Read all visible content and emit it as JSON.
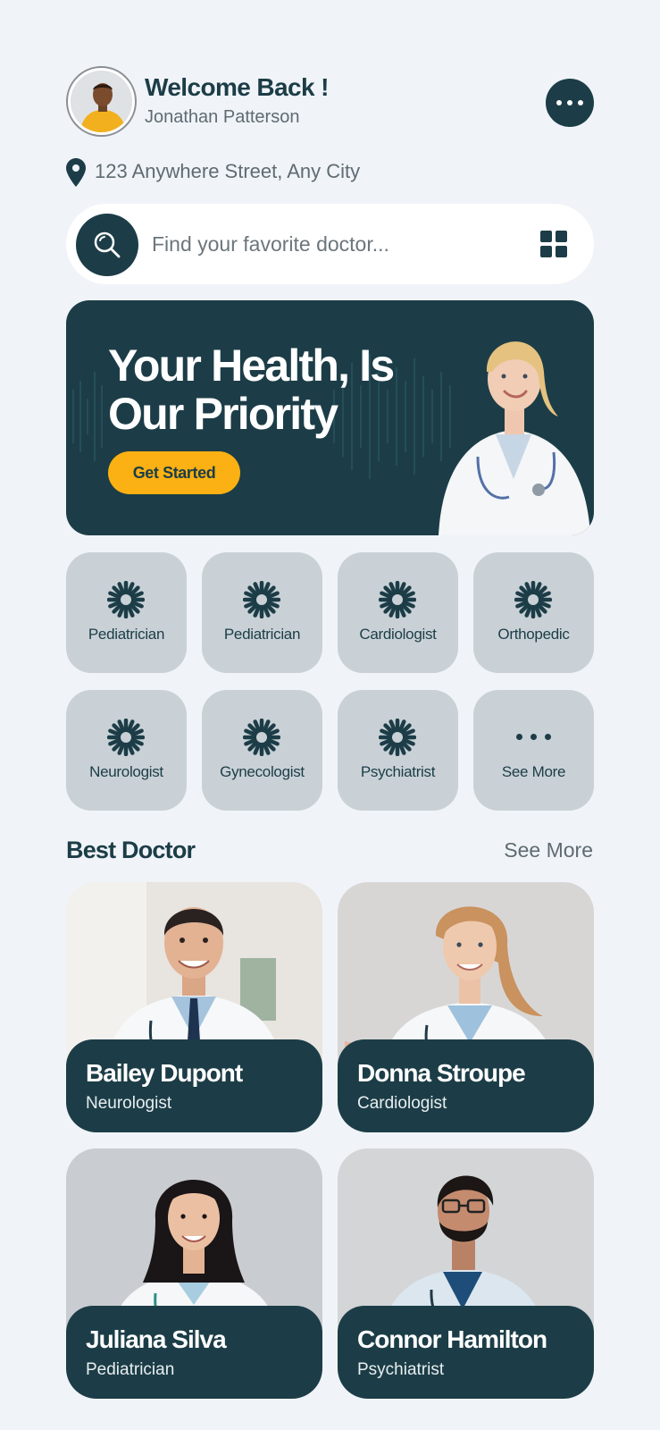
{
  "header": {
    "welcome": "Welcome Back !",
    "username": "Jonathan Patterson",
    "avatar_icon": "user-avatar",
    "menu_icon": "more-horizontal-icon"
  },
  "location": {
    "icon": "map-pin-icon",
    "address": "123 Anywhere Street, Any City"
  },
  "search": {
    "placeholder": "Find your favorite doctor...",
    "search_icon": "search-icon",
    "filter_icon": "grid-icon"
  },
  "banner": {
    "title_line1": "Your Health, Is",
    "title_line2": "Our Priority",
    "cta_label": "Get Started"
  },
  "categories": [
    {
      "label": "Pediatrician",
      "icon": "starburst-icon"
    },
    {
      "label": "Pediatrician",
      "icon": "starburst-icon"
    },
    {
      "label": "Cardiologist",
      "icon": "starburst-icon"
    },
    {
      "label": "Orthopedic",
      "icon": "starburst-icon"
    },
    {
      "label": "Neurologist",
      "icon": "starburst-icon"
    },
    {
      "label": "Gynecologist",
      "icon": "starburst-icon"
    },
    {
      "label": "Psychiatrist",
      "icon": "starburst-icon"
    },
    {
      "label": "See More",
      "icon": "more-horizontal-icon"
    }
  ],
  "best_doctor": {
    "title": "Best Doctor",
    "see_more": "See More",
    "doctors": [
      {
        "name": "Bailey Dupont",
        "specialty": "Neurologist"
      },
      {
        "name": "Donna Stroupe",
        "specialty": "Cardiologist"
      },
      {
        "name": "Juliana Silva",
        "specialty": "Pediatrician"
      },
      {
        "name": "Connor Hamilton",
        "specialty": "Psychiatrist"
      }
    ]
  },
  "colors": {
    "primary": "#1c3d47",
    "accent": "#fbb113",
    "background": "#f0f4f8",
    "tile": "#c9d1d6"
  }
}
